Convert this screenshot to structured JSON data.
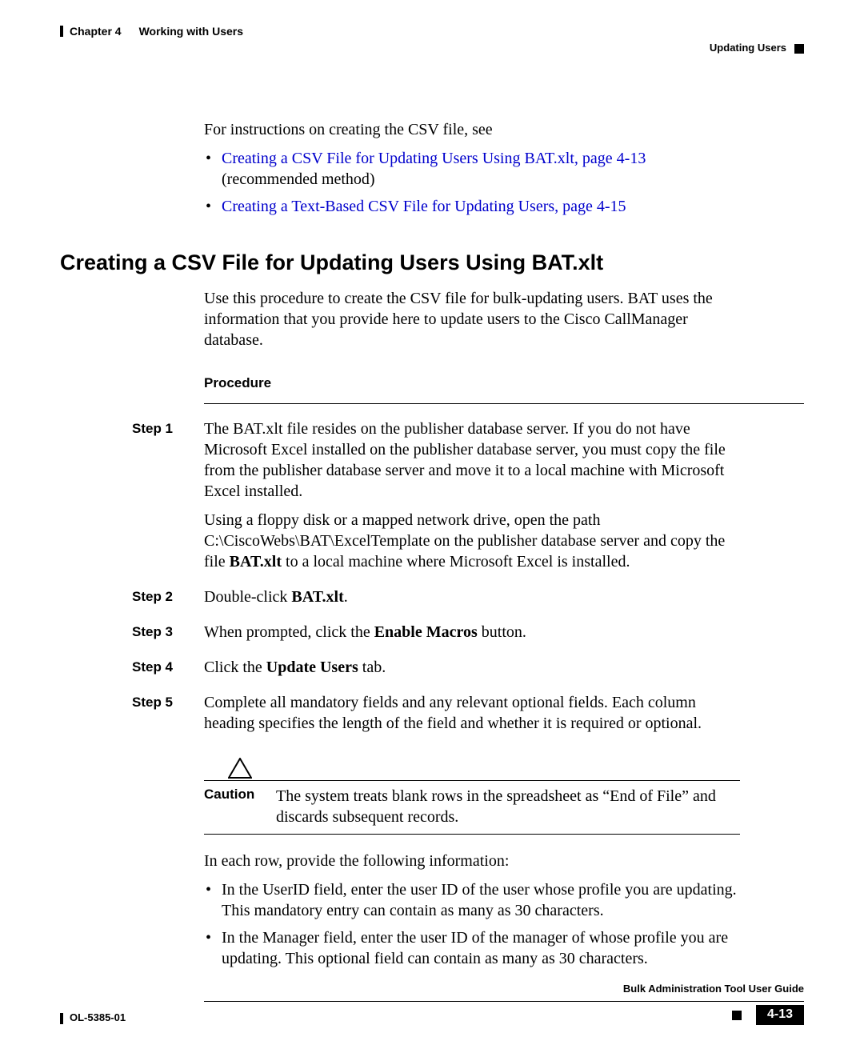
{
  "header": {
    "chapter": "Chapter 4",
    "title": "Working with Users",
    "section": "Updating Users"
  },
  "intro": {
    "lead": "For instructions on creating the CSV file, see",
    "bullets": [
      {
        "link": "Creating a CSV File for Updating Users Using BAT.xlt, page 4-13",
        "tail": " (recommended method)"
      },
      {
        "link": "Creating a Text-Based CSV File for Updating Users, page 4-15",
        "tail": ""
      }
    ]
  },
  "h2": "Creating a CSV File for Updating Users Using BAT.xlt",
  "h2_body": "Use this procedure to create the CSV file for bulk-updating users. BAT uses the information that you provide here to update users to the Cisco CallManager database.",
  "procedure_heading": "Procedure",
  "steps": {
    "s1": {
      "label": "Step 1",
      "p1": "The BAT.xlt file resides on the publisher database server. If you do not have Microsoft Excel installed on the publisher database server, you must copy the file from the publisher database server and move it to a local machine with Microsoft Excel installed.",
      "p2a": "Using a floppy disk or a mapped network drive, open the path C:\\CiscoWebs\\BAT\\ExcelTemplate on the publisher database server and copy the file ",
      "p2b": "BAT.xlt",
      "p2c": " to a local machine where Microsoft Excel is installed."
    },
    "s2": {
      "label": "Step 2",
      "a": "Double-click ",
      "b": "BAT.xlt",
      "c": "."
    },
    "s3": {
      "label": "Step 3",
      "a": "When prompted, click the ",
      "b": "Enable Macros",
      "c": " button."
    },
    "s4": {
      "label": "Step 4",
      "a": "Click the ",
      "b": "Update Users",
      "c": " tab."
    },
    "s5": {
      "label": "Step 5",
      "a": "Complete all mandatory fields and any relevant optional fields. Each column heading specifies the length of the field and whether it is required or optional."
    }
  },
  "caution": {
    "label": "Caution",
    "text": "The system treats blank rows in the spreadsheet as “End of File” and discards subsequent records."
  },
  "after_caution": "In each row, provide the following information:",
  "row_bullets": [
    "In the UserID field, enter the user ID of the user whose profile you are updating. This mandatory entry can contain as many as 30 characters.",
    "In the Manager field, enter the user ID of the manager of whose profile you are updating. This optional field can contain as many as 30 characters."
  ],
  "footer": {
    "guide": "Bulk Administration Tool User Guide",
    "doc": "OL-5385-01",
    "page": "4-13"
  }
}
